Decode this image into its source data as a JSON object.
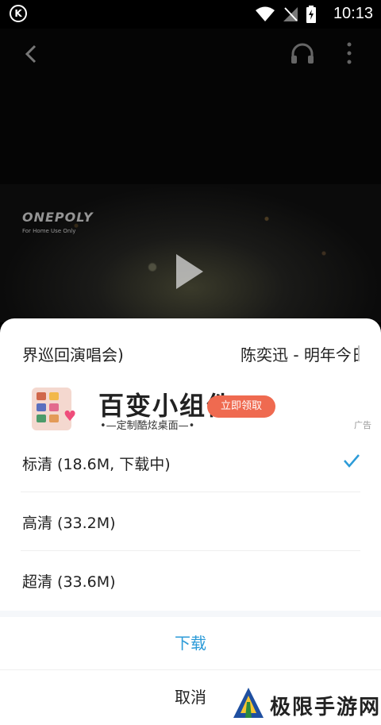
{
  "status_bar": {
    "app_logo_letter": "K",
    "time": "10:13",
    "icons": [
      "wifi-icon",
      "signal-off-icon",
      "battery-charging-icon"
    ]
  },
  "video": {
    "brand_text": "ONEPOLY",
    "brand_sub": "For Home Use Only",
    "controls": [
      "back-icon",
      "headphone-icon",
      "more-icon",
      "play-icon"
    ]
  },
  "sheet": {
    "title_left": "界巡回演唱会)",
    "title_right": "陈奕迅 - 明年今日",
    "ad": {
      "title": "百变小组件",
      "subtitle": "•—定制酷炫桌面—•",
      "cta": "立即领取",
      "tag": "广告"
    },
    "options": [
      {
        "label": "标清 (18.6M, 下载中)",
        "selected": true
      },
      {
        "label": "高清 (33.2M)",
        "selected": false
      },
      {
        "label": "超清 (33.6M)",
        "selected": false
      }
    ],
    "download_label": "下载",
    "cancel_label": "取消",
    "accent_color": "#2c9bd8"
  },
  "watermark": {
    "text": "极限手游网"
  }
}
